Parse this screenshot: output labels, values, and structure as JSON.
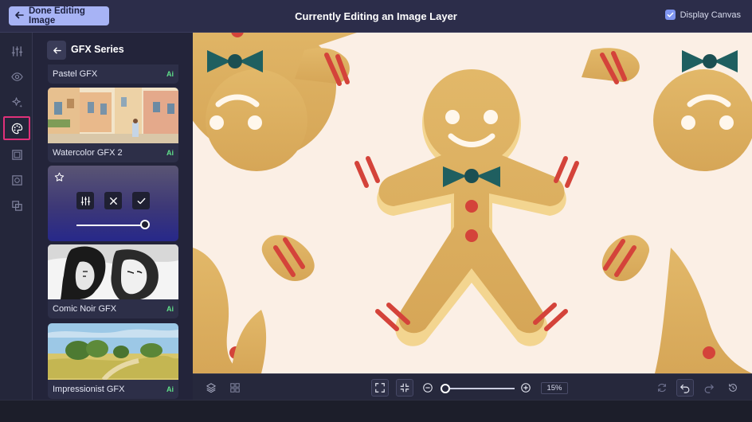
{
  "topbar": {
    "done_label": "Done Editing Image",
    "title": "Currently Editing an Image Layer",
    "display_canvas_label": "Display Canvas",
    "display_canvas_checked": true
  },
  "rail": {
    "items": [
      "adjust-icon",
      "eye-icon",
      "sparkle-icon",
      "palette-icon",
      "frame-icon",
      "crop-frame-icon",
      "layers-stack-icon"
    ],
    "active": "palette-icon",
    "active_outline_color": "#e0317a"
  },
  "panel": {
    "title": "GFX Series",
    "cards": [
      {
        "label": "Pastel GFX",
        "badge": "Ai"
      },
      {
        "label": "Watercolor GFX 2",
        "badge": "Ai"
      },
      {
        "label": "Comic Noir GFX",
        "badge": "Ai"
      },
      {
        "label": "Impressionist GFX",
        "badge": "Ai"
      }
    ],
    "active_card": {
      "icons": [
        "star-icon",
        "adjust-icon",
        "close-icon",
        "check-icon"
      ],
      "intensity": 1.0
    }
  },
  "canvas": {
    "background": "#fbefe5",
    "subject": "gingerbread-man"
  },
  "bottombar": {
    "zoom_value": "15%",
    "zoom_fraction": 0.0
  },
  "colors": {
    "accent": "#a7b3f5",
    "ai_badge": "#5fe08a",
    "checkbox": "#7f95f0"
  }
}
